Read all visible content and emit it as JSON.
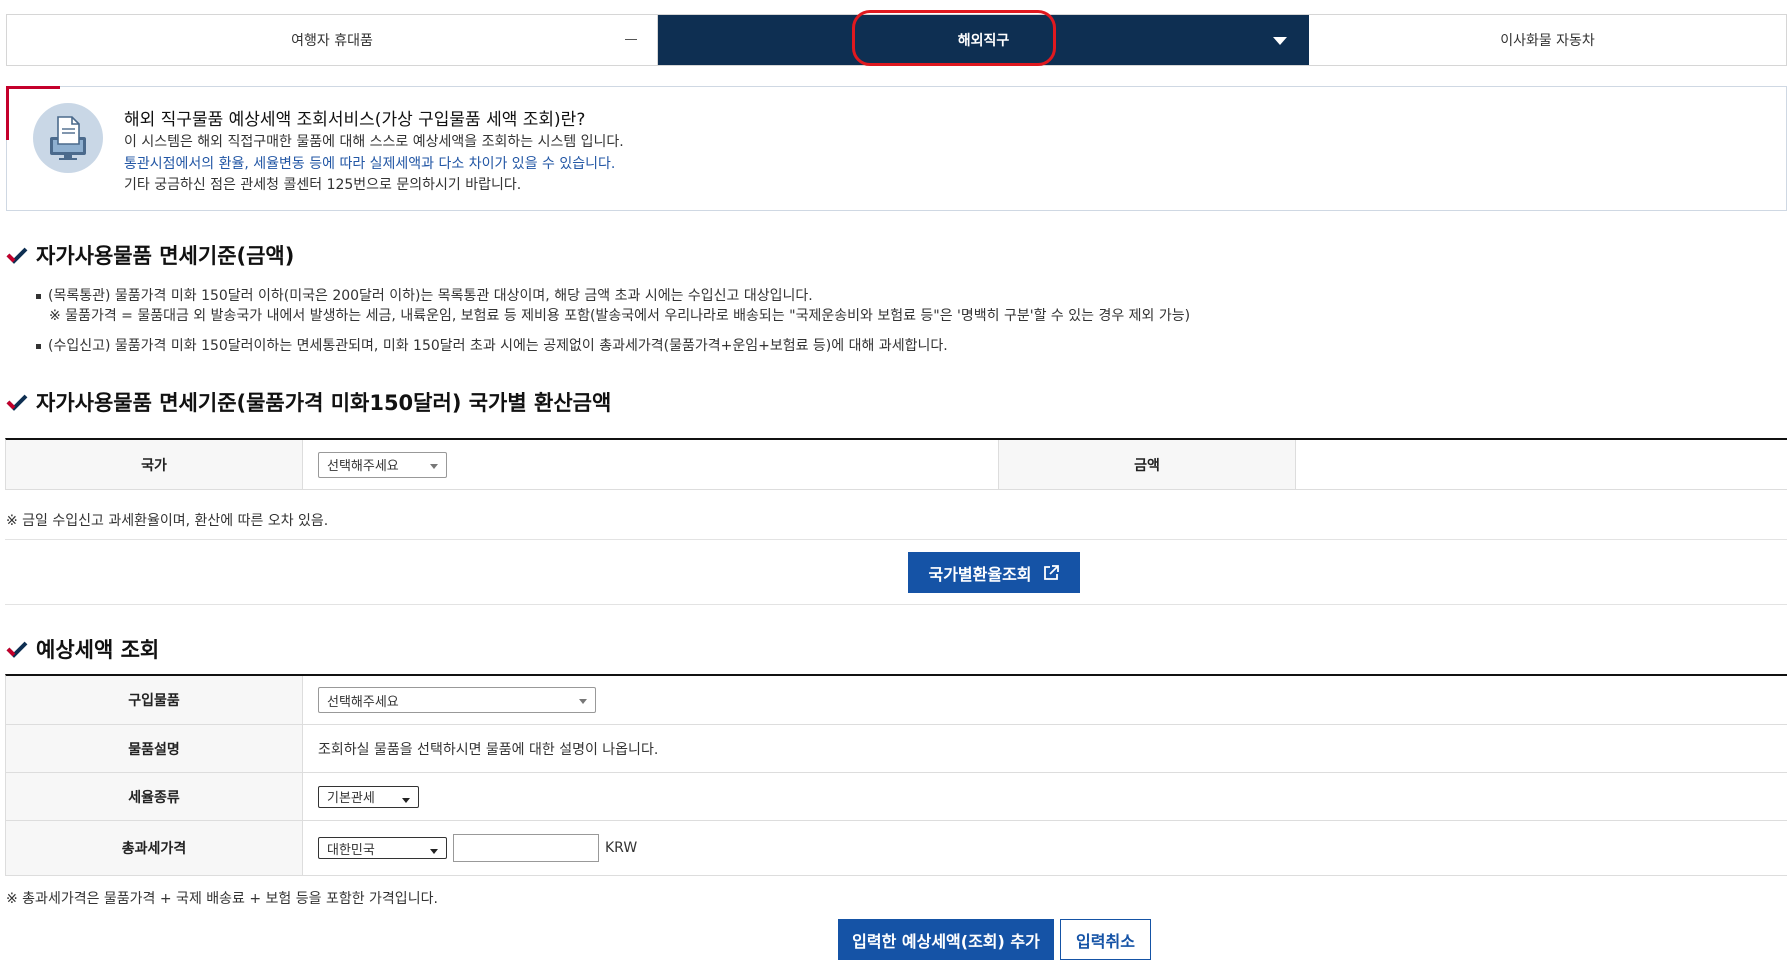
{
  "tabs": [
    {
      "label": "여행자 휴대품"
    },
    {
      "label": "해외직구"
    },
    {
      "label": "이사화물 자동차"
    }
  ],
  "info": {
    "title": "해외 직구물품 예상세액 조회서비스(가상 구입물품 세액 조회)란?",
    "line1": "이 시스템은 해외 직접구매한 물품에 대해 스스로 예상세액을 조회하는 시스템 입니다.",
    "line2": "통관시점에서의 환율, 세율변동 등에 따라 실제세액과 다소 차이가 있을 수 있습니다.",
    "line3": "기타 궁금하신 점은 관세청 콜센터 125번으로 문의하시기 바랍니다."
  },
  "section1": {
    "heading": "자가사용물품 면세기준(금액)",
    "bullet1": "(목록통관) 물품가격 미화 150달러 이하(미국은 200달러 이하)는 목록통관 대상이며, 해당 금액 초과 시에는 수입신고 대상입니다.",
    "bullet1_note": "※ 물품가격 = 물품대금 외 발송국가 내에서 발생하는 세금, 내륙운임, 보험료 등 제비용 포함(발송국에서 우리나라로 배송되는 \"국제운송비와 보험료 등\"은 '명백히 구분'할 수 있는 경우 제외 가능)",
    "bullet2": "(수입신고) 물품가격 미화 150달러이하는 면세통관되며, 미화 150달러 초과 시에는 공제없이 총과세가격(물품가격+운임+보험료 등)에 대해 과세합니다."
  },
  "section2": {
    "heading": "자가사용물품 면세기준(물품가격 미화150달러) 국가별 환산금액",
    "country_label": "국가",
    "country_select": "선택해주세요",
    "amount_label": "금액",
    "note": "※  금일 수입신고 과세환율이며, 환산에 따른 오차 있음.",
    "rate_button": "국가별환율조회"
  },
  "section3": {
    "heading": "예상세액 조회",
    "item_label": "구입물품",
    "item_select": "선택해주세요",
    "desc_label": "물품설명",
    "desc_text": "조회하실 물품을 선택하시면 물품에 대한 설명이 나옵니다.",
    "tax_label": "세율종류",
    "tax_select": "기본관세",
    "total_label": "총과세가격",
    "total_country": "대한민국",
    "currency": "KRW",
    "note": "※  총과세가격은 물품가격 + 국제 배송료 + 보험 등을 포함한 가격입니다.",
    "add_button": "입력한 예상세액(조회) 추가",
    "cancel_button": "입력취소"
  },
  "colors": {
    "tab_active": "#0e2f52",
    "accent_blue": "#1553a6",
    "highlight_red": "#e0191f",
    "info_red": "#c4002b"
  },
  "icons": [
    "document-monitor-icon",
    "check-icon",
    "external-link-icon",
    "chevron-down-icon",
    "minus-icon"
  ]
}
